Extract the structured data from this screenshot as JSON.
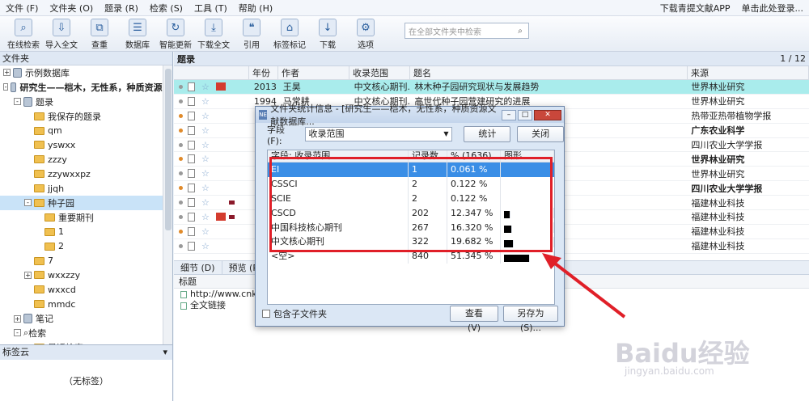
{
  "menu": {
    "items": [
      "文件 (F)",
      "文件夹 (O)",
      "题录 (R)",
      "检索 (S)",
      "工具 (T)",
      "帮助 (H)"
    ],
    "right": [
      "下载青提文献APP",
      "单击此处登录..."
    ]
  },
  "toolbar": {
    "buttons": [
      {
        "label": "在线检索",
        "icon": "magnifier-icon"
      },
      {
        "label": "导入全文",
        "icon": "import-icon"
      },
      {
        "label": "查重",
        "icon": "duplicate-search-icon"
      },
      {
        "label": "数据库",
        "icon": "database-icon"
      },
      {
        "label": "智能更新",
        "icon": "smart-update-icon"
      },
      {
        "label": "下载全文",
        "icon": "download-fulltext-icon"
      },
      {
        "label": "引用",
        "icon": "cite-icon"
      },
      {
        "label": "标签标记",
        "icon": "tag-icon"
      },
      {
        "label": "下载",
        "icon": "download-icon"
      },
      {
        "label": "选项",
        "icon": "options-icon"
      }
    ],
    "search_placeholder": "在全部文件夹中检索"
  },
  "left_panel": {
    "title": "文件夹",
    "tree": [
      {
        "label": "示例数据库",
        "indent": 0,
        "kind": "db",
        "pm": "+"
      },
      {
        "label": "研究生——桤木，无性系，种质资源...",
        "indent": 0,
        "kind": "db",
        "pm": "-",
        "bold": true
      },
      {
        "label": "题录",
        "indent": 1,
        "kind": "list",
        "pm": "-"
      },
      {
        "label": "我保存的题录",
        "indent": 2,
        "kind": "folder"
      },
      {
        "label": "qm",
        "indent": 2,
        "kind": "folder"
      },
      {
        "label": "yswxx",
        "indent": 2,
        "kind": "folder"
      },
      {
        "label": "zzzy",
        "indent": 2,
        "kind": "folder"
      },
      {
        "label": "zzywxxpz",
        "indent": 2,
        "kind": "folder"
      },
      {
        "label": "jjqh",
        "indent": 2,
        "kind": "folder"
      },
      {
        "label": "种子园",
        "indent": 2,
        "kind": "folder",
        "pm": "-",
        "selected": true
      },
      {
        "label": "重要期刊",
        "indent": 3,
        "kind": "folder"
      },
      {
        "label": "1",
        "indent": 3,
        "kind": "folder"
      },
      {
        "label": "2",
        "indent": 3,
        "kind": "folder"
      },
      {
        "label": "7",
        "indent": 2,
        "kind": "folder"
      },
      {
        "label": "wxxzzy",
        "indent": 2,
        "kind": "folder",
        "pm": "+"
      },
      {
        "label": "wxxcd",
        "indent": 2,
        "kind": "folder"
      },
      {
        "label": "mmdc",
        "indent": 2,
        "kind": "folder"
      },
      {
        "label": "笔记",
        "indent": 1,
        "kind": "list",
        "pm": "+"
      },
      {
        "label": "检索",
        "indent": 1,
        "kind": "search",
        "pm": "-"
      },
      {
        "label": "最近检索",
        "indent": 2,
        "kind": "folder"
      }
    ],
    "tag_cloud_title": "标签云",
    "tag_cloud_empty": "（无标签）"
  },
  "records": {
    "title": "题录",
    "pager": "1 / 12",
    "columns": [
      "年份",
      "作者",
      "收录范围",
      "题名",
      "来源"
    ],
    "rows": [
      {
        "year": "2013",
        "author": "王昊",
        "scope": "中文核心期刊...",
        "title": "林木种子园研究现状与发展趋势",
        "source": "世界林业研究",
        "flag": true,
        "highlight": true,
        "orange": false,
        "bold": false
      },
      {
        "year": "1994",
        "author": "马常耕",
        "scope": "中文核心期刊...",
        "title": "高世代种子园营建研究的进展",
        "source": "世界林业研究",
        "orange": false
      },
      {
        "year": "",
        "author": "",
        "scope": "",
        "title": "的评价",
        "source": "热带亚热带植物学报",
        "orange": true
      },
      {
        "year": "",
        "author": "",
        "scope": "",
        "title": "",
        "source": "广东农业科学",
        "orange": true,
        "bold": true
      },
      {
        "year": "",
        "author": "",
        "scope": "",
        "title": "",
        "source": "四川农业大学学报",
        "orange": false
      },
      {
        "year": "",
        "author": "",
        "scope": "",
        "title": "",
        "source": "世界林业研究",
        "orange": true,
        "bold": true
      },
      {
        "year": "",
        "author": "",
        "scope": "",
        "title": "",
        "source": "世界林业研究",
        "orange": false
      },
      {
        "year": "",
        "author": "",
        "scope": "",
        "title": "cinatum）及防治初探",
        "source": "四川农业大学学报",
        "orange": true,
        "bold": true,
        "titlebold": true
      },
      {
        "year": "",
        "author": "",
        "scope": "",
        "title": "",
        "source": "福建林业科技",
        "orange": false,
        "sq": true
      },
      {
        "year": "",
        "author": "",
        "scope": "",
        "title": "",
        "source": "福建林业科技",
        "orange": false,
        "flag": true,
        "sq": true
      },
      {
        "year": "",
        "author": "",
        "scope": "",
        "title": "究",
        "source": "福建林业科技",
        "orange": true
      },
      {
        "year": "",
        "author": "",
        "scope": "",
        "title": "--以福建省邵武卫闽林场马尾松第...",
        "source": "福建林业科技",
        "orange": false
      }
    ]
  },
  "bottom": {
    "tabs": [
      "细节 (D)",
      "预览 (P)"
    ],
    "header": "标题",
    "lines": [
      "http://www.cnki.net",
      "全文链接"
    ]
  },
  "dialog": {
    "title": "文件夹统计信息 - [研究生——桤木，无性系，种质资源文献数据库...",
    "field_label": "字段 (F):",
    "field_value": "收录范围",
    "stat_button": "统计",
    "close_button": "关闭",
    "columns": [
      "字段: 收录范围",
      "记录数",
      "% (1636)",
      "图形"
    ],
    "rows": [
      {
        "name": "EI",
        "count": "1",
        "pct": "0.061 %",
        "share": 0.061
      },
      {
        "name": "CSSCI",
        "count": "2",
        "pct": "0.122 %",
        "share": 0.122
      },
      {
        "name": "SCIE",
        "count": "2",
        "pct": "0.122 %",
        "share": 0.122
      },
      {
        "name": "CSCD",
        "count": "202",
        "pct": "12.347 %",
        "share": 12.347
      },
      {
        "name": "中国科技核心期刊",
        "count": "267",
        "pct": "16.320 %",
        "share": 16.32
      },
      {
        "name": "中文核心期刊",
        "count": "322",
        "pct": "19.682 %",
        "share": 19.682
      },
      {
        "name": "<空>",
        "count": "840",
        "pct": "51.345 %",
        "share": 51.345
      }
    ],
    "include_sub": "包含子文件夹",
    "view_button": "查看 (V)",
    "saveas_button": "另存为 (S)..."
  },
  "watermark": {
    "logo": "Baidu经验",
    "url": "jingyan.baidu.com"
  },
  "colors": {
    "highlight_row": "#a9ecec",
    "selected_row": "#3a8ee6",
    "annotation": "#e01f28"
  }
}
